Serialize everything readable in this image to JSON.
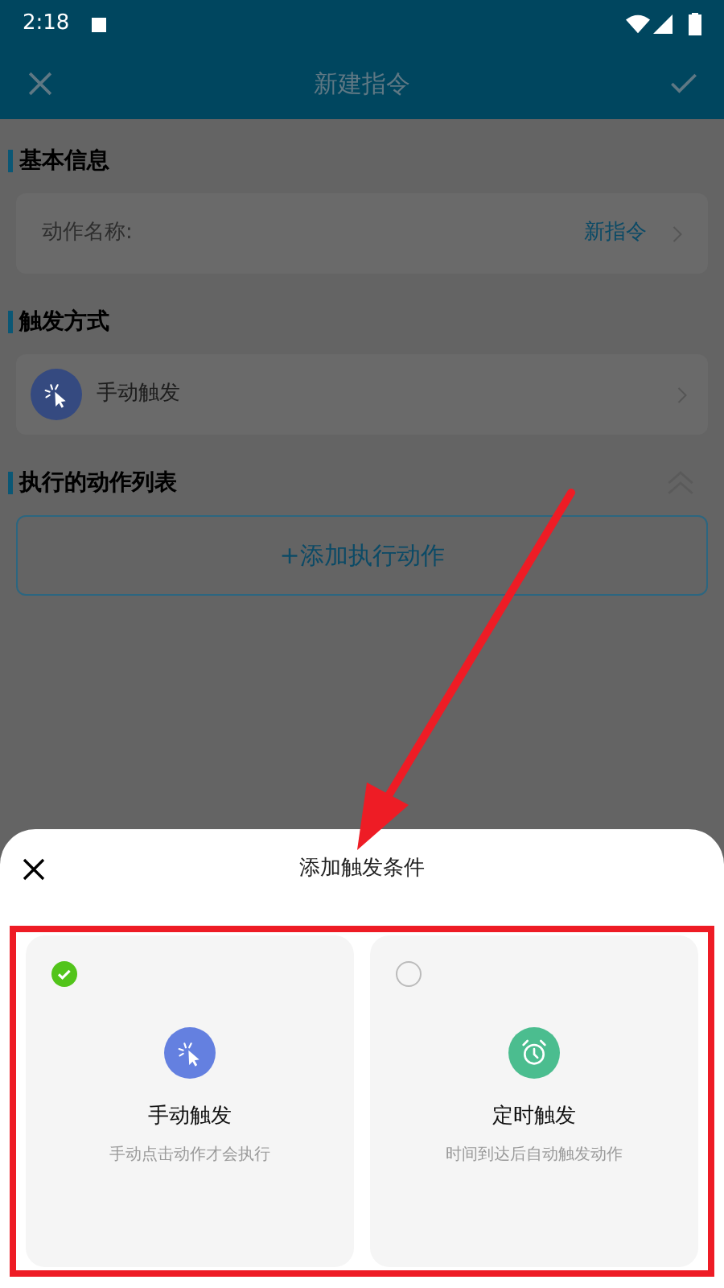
{
  "status_bar": {
    "time": "2:18"
  },
  "header": {
    "title": "新建指令"
  },
  "sections": [
    {
      "title": "基本信息",
      "kind": "field",
      "label": "动作名称:",
      "value": "新指令"
    },
    {
      "title": "触发方式",
      "kind": "trigger",
      "label": "手动触发"
    },
    {
      "title": "执行的动作列表",
      "kind": "actions",
      "button": "+添加执行动作"
    }
  ],
  "sheet": {
    "title": "添加触发条件",
    "options": [
      {
        "kind": "manual",
        "title": "手动触发",
        "description": "手动点击动作才会执行",
        "selected": true
      },
      {
        "kind": "timer",
        "title": "定时触发",
        "description": "时间到达后自动触发动作",
        "selected": false
      }
    ]
  }
}
